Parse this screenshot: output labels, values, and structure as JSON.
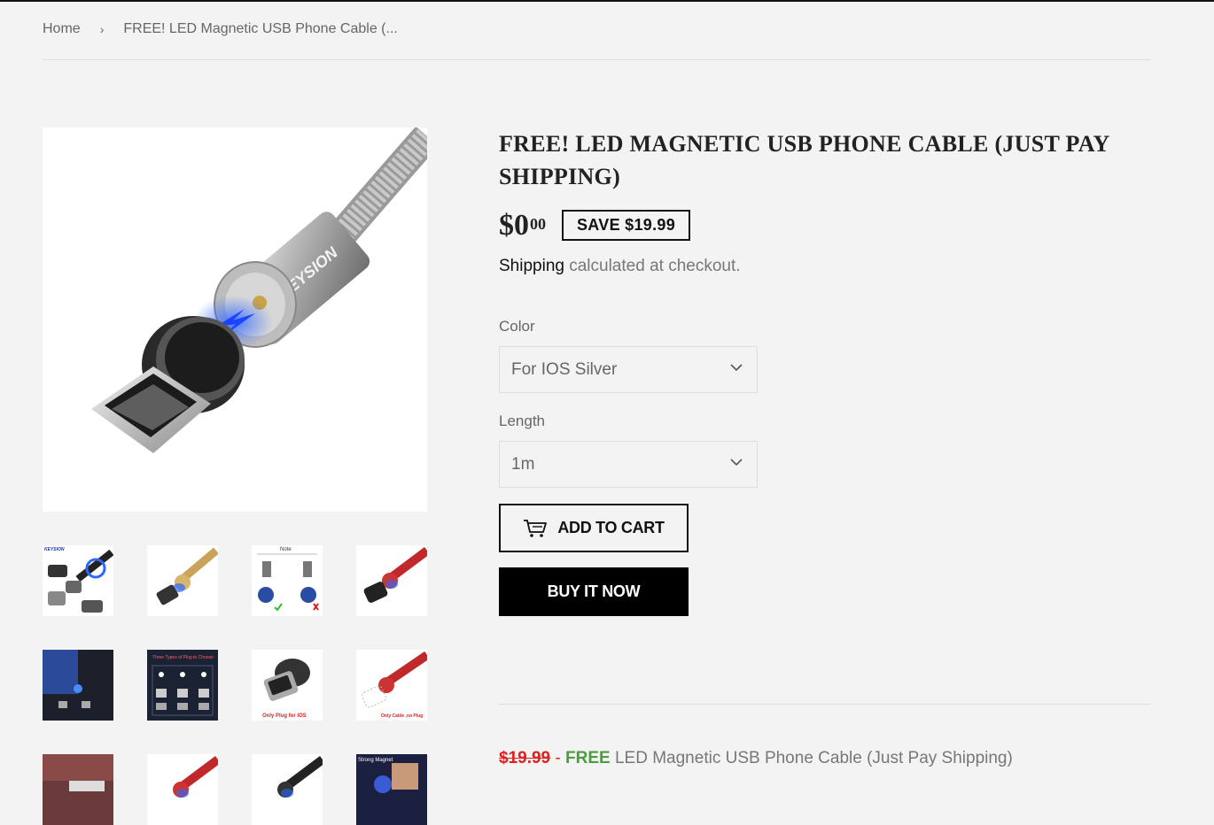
{
  "breadcrumb": {
    "home": "Home",
    "separator": "›",
    "current": "FREE! LED Magnetic USB Phone Cable (..."
  },
  "product": {
    "title": "FREE! LED MAGNETIC USB PHONE CABLE (JUST PAY SHIPPING)",
    "price_main": "$0",
    "price_cents": "00",
    "save_badge": "SAVE $19.99",
    "shipping_link": "Shipping",
    "shipping_text": " calculated at checkout.",
    "main_image_brand": "KEYSION"
  },
  "options": {
    "color_label": "Color",
    "color_value": "For IOS Silver",
    "length_label": "Length",
    "length_value": "1m"
  },
  "buttons": {
    "add_to_cart": "ADD TO CART",
    "buy_now": "BUY IT NOW"
  },
  "thumbnails": {
    "t1_brand": "KEYSION",
    "t3_title": "Note",
    "t6_title": "Three Types of Plug to Choose",
    "t7_caption": "Only Plug for IOS",
    "t8_caption": "Only Cable ,no Plug",
    "t12_caption": "Strong Magnet"
  },
  "description": {
    "old_price": "$19.99",
    "dash": " - ",
    "free": "FREE",
    "rest": " LED Magnetic USB Phone Cable (Just Pay Shipping)"
  },
  "colors": {
    "background": "#f3f3f3",
    "old_price_red": "#e02020",
    "free_green": "#4a9d3c",
    "black": "#000000"
  }
}
